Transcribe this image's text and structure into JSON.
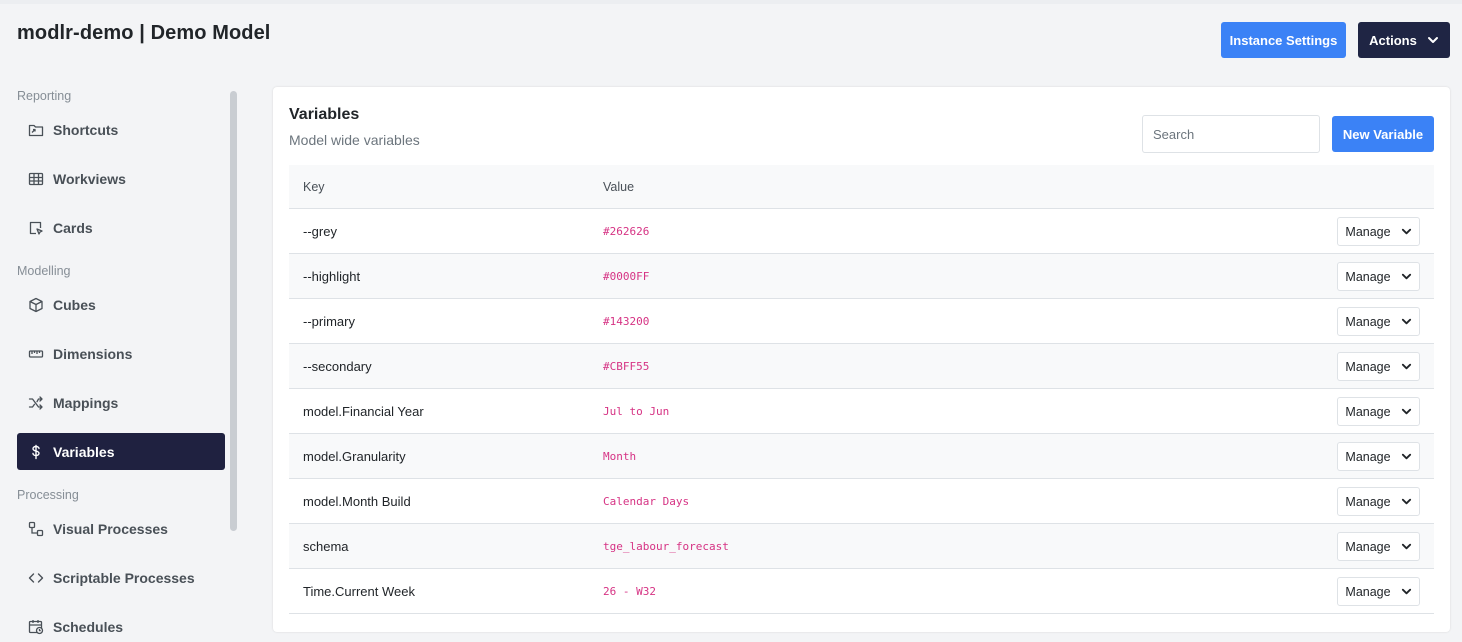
{
  "header": {
    "title": "modlr-demo | Demo Model",
    "instance_settings_label": "Instance Settings",
    "actions_label": "Actions"
  },
  "sidebar": {
    "sections": {
      "reporting": "Reporting",
      "modelling": "Modelling",
      "processing": "Processing"
    },
    "items": [
      {
        "label": "Shortcuts",
        "icon": "folder-shortcut-icon"
      },
      {
        "label": "Workviews",
        "icon": "table-grid-icon"
      },
      {
        "label": "Cards",
        "icon": "card-cursor-icon"
      },
      {
        "label": "Cubes",
        "icon": "cube-icon"
      },
      {
        "label": "Dimensions",
        "icon": "ruler-icon"
      },
      {
        "label": "Mappings",
        "icon": "shuffle-icon"
      },
      {
        "label": "Variables",
        "icon": "dollar-icon",
        "active": true
      },
      {
        "label": "Visual Processes",
        "icon": "flow-icon"
      },
      {
        "label": "Scriptable Processes",
        "icon": "code-icon"
      },
      {
        "label": "Schedules",
        "icon": "calendar-icon"
      }
    ]
  },
  "main": {
    "title": "Variables",
    "subtitle": "Model wide variables",
    "search_placeholder": "Search",
    "new_button_label": "New Variable",
    "columns": [
      "Key",
      "Value"
    ],
    "manage_label": "Manage",
    "rows": [
      {
        "key": "--grey",
        "value": "#262626"
      },
      {
        "key": "--highlight",
        "value": "#0000FF"
      },
      {
        "key": "--primary",
        "value": "#143200"
      },
      {
        "key": "--secondary",
        "value": "#CBFF55"
      },
      {
        "key": "model.Financial Year",
        "value": "Jul to Jun"
      },
      {
        "key": "model.Granularity",
        "value": "Month"
      },
      {
        "key": "model.Month Build",
        "value": "Calendar Days"
      },
      {
        "key": "schema",
        "value": "tge_labour_forecast"
      },
      {
        "key": "Time.Current Week",
        "value": "26 - W32"
      }
    ]
  },
  "colors": {
    "primary_blue": "#3b82f6",
    "dark_navy": "#1f2544",
    "code_pink": "#d63384"
  }
}
